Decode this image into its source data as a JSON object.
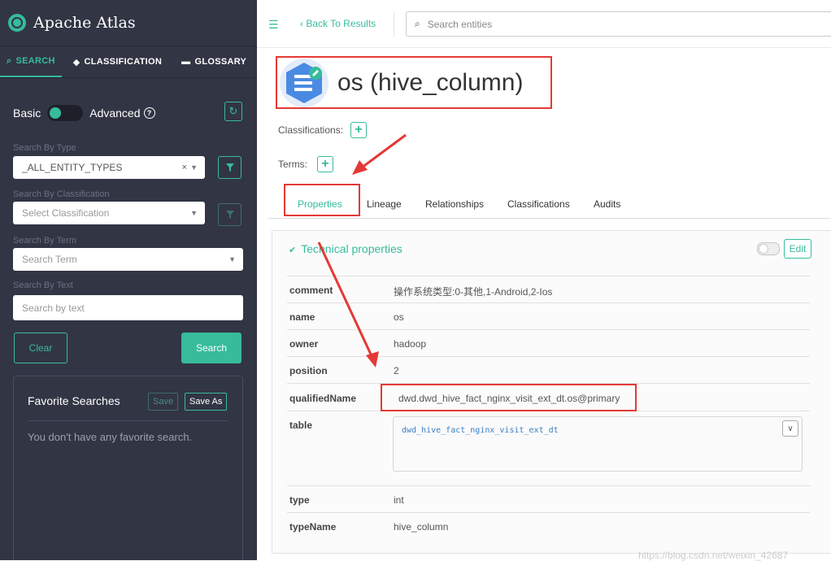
{
  "sidebar": {
    "brand": {
      "name": "Apache",
      "accent": "Atlas"
    },
    "tabs": [
      {
        "label": "SEARCH",
        "icon": "search-icon"
      },
      {
        "label": "CLASSIFICATION",
        "icon": "tag-icon"
      },
      {
        "label": "GLOSSARY",
        "icon": "folder-icon"
      }
    ],
    "mode": {
      "basic": "Basic",
      "advanced": "Advanced"
    },
    "type_label": "Search By Type",
    "type_value": "_ALL_ENTITY_TYPES",
    "classification_label": "Search By Classification",
    "classification_placeholder": "Select Classification",
    "term_label": "Search By Term",
    "term_placeholder": "Search Term",
    "text_label": "Search By Text",
    "text_placeholder": "Search by text",
    "clear_label": "Clear",
    "search_label": "Search",
    "favorites": {
      "title": "Favorite Searches",
      "save": "Save",
      "save_as": "Save As",
      "empty": "You don't have any favorite search."
    }
  },
  "topbar": {
    "back": "Back To Results",
    "search_placeholder": "Search entities"
  },
  "entity": {
    "title": "os (hive_column)",
    "classifications_label": "Classifications:",
    "terms_label": "Terms:"
  },
  "tabs": [
    "Properties",
    "Lineage",
    "Relationships",
    "Classifications",
    "Audits"
  ],
  "properties": {
    "title": "Technical properties",
    "edit": "Edit",
    "rows": [
      {
        "key": "comment",
        "value": "操作系统类型:0-其他,1-Android,2-Ios"
      },
      {
        "key": "name",
        "value": "os"
      },
      {
        "key": "owner",
        "value": "hadoop"
      },
      {
        "key": "position",
        "value": "2"
      },
      {
        "key": "qualifiedName",
        "value": "dwd.dwd_hive_fact_nginx_visit_ext_dt.os@primary"
      },
      {
        "key": "table",
        "value": "dwd_hive_fact_nginx_visit_ext_dt"
      },
      {
        "key": "type",
        "value": "int"
      },
      {
        "key": "typeName",
        "value": "hive_column"
      }
    ]
  },
  "watermark": "https://blog.csdn.net/weixin_42687",
  "colors": {
    "accent": "#37bb9b",
    "sidebar": "#323544",
    "highlight": "#e53935"
  }
}
